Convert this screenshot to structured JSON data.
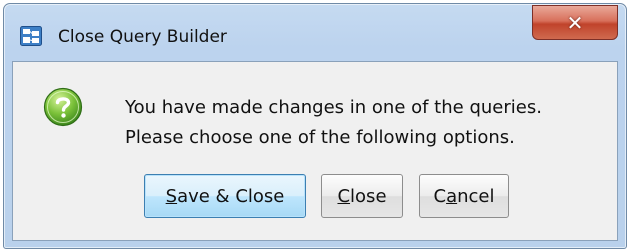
{
  "window": {
    "title": "Close Query Builder",
    "app_icon": "query-builder-icon",
    "close_glyph": "✕"
  },
  "dialog": {
    "icon": "question-icon",
    "message_line1": "You have made changes in one of the queries.",
    "message_line2": "Please choose one of the following options."
  },
  "buttons": {
    "save_close": {
      "mnemonic": "S",
      "rest": "ave & Close"
    },
    "close": {
      "mnemonic": "C",
      "rest": "lose"
    },
    "cancel": {
      "prefix": "C",
      "mnemonic": "a",
      "rest": "ncel"
    }
  },
  "colors": {
    "titlebar": "#c5daf1",
    "close_button": "#c7492f",
    "default_button": "#bee6fd",
    "icon_green": "#5fae2e"
  }
}
